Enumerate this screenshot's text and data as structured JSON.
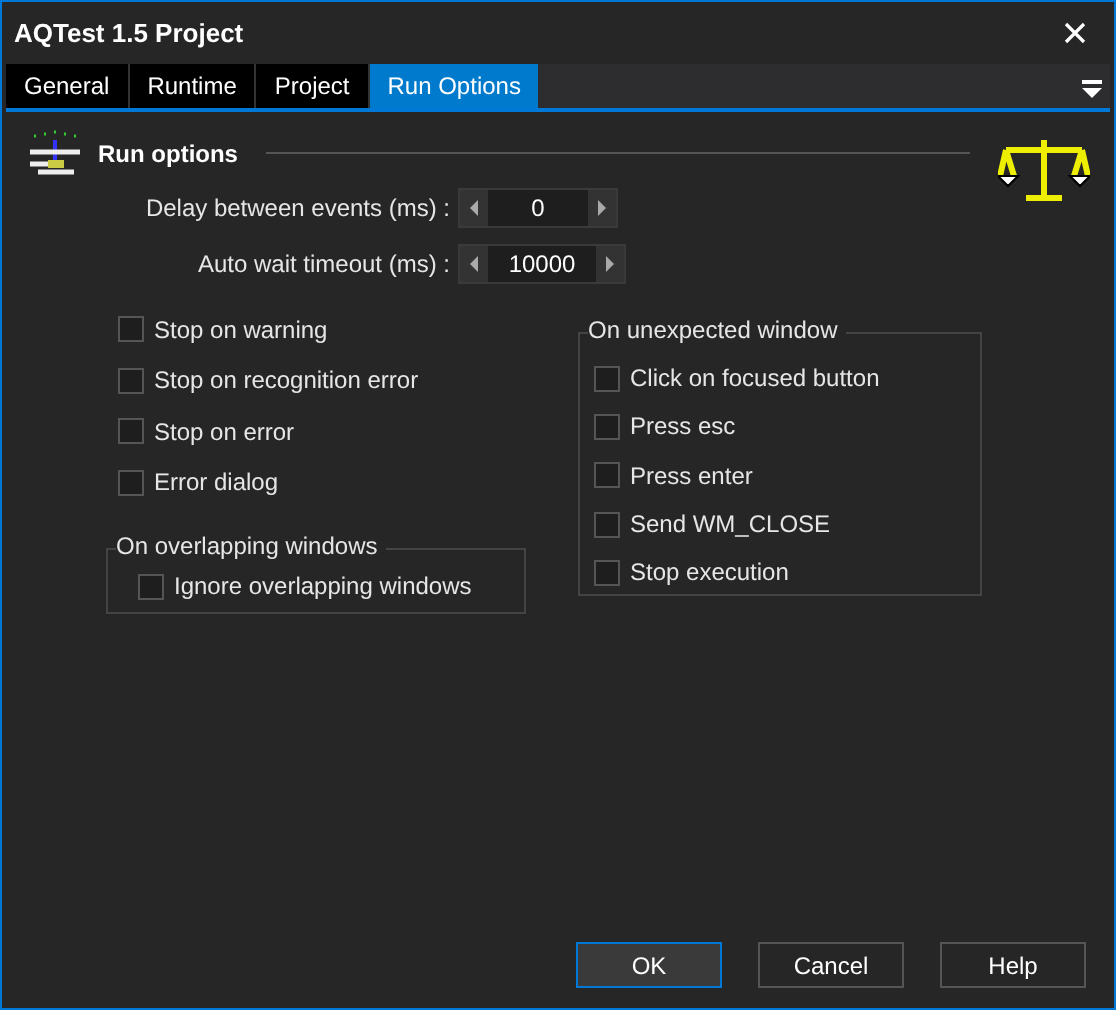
{
  "window": {
    "title": "AQTest 1.5 Project"
  },
  "tabs": [
    {
      "label": "General",
      "selected": false
    },
    {
      "label": "Runtime",
      "selected": false
    },
    {
      "label": "Project",
      "selected": false
    },
    {
      "label": "Run Options",
      "selected": true
    }
  ],
  "section": {
    "title": "Run options"
  },
  "fields": [
    {
      "label": "Delay between events (ms) :",
      "value": "0"
    },
    {
      "label": "Auto wait timeout (ms) :",
      "value": "10000"
    }
  ],
  "options": [
    {
      "label": "Stop on warning",
      "checked": false
    },
    {
      "label": "Stop on recognition error",
      "checked": false
    },
    {
      "label": "Stop on error",
      "checked": false
    },
    {
      "label": "Error dialog",
      "checked": false
    }
  ],
  "overlapping_group": {
    "title": "On overlapping windows",
    "options": [
      {
        "label": "Ignore overlapping windows",
        "checked": false
      }
    ]
  },
  "unexpected_group": {
    "title": "On unexpected window",
    "options": [
      {
        "label": "Click on focused button",
        "checked": false
      },
      {
        "label": "Press esc",
        "checked": false
      },
      {
        "label": "Press enter",
        "checked": false
      },
      {
        "label": "Send WM_CLOSE",
        "checked": false
      },
      {
        "label": "Stop execution",
        "checked": false
      }
    ]
  },
  "buttons": [
    {
      "label": "OK",
      "default": true
    },
    {
      "label": "Cancel",
      "default": false
    },
    {
      "label": "Help",
      "default": false
    }
  ]
}
